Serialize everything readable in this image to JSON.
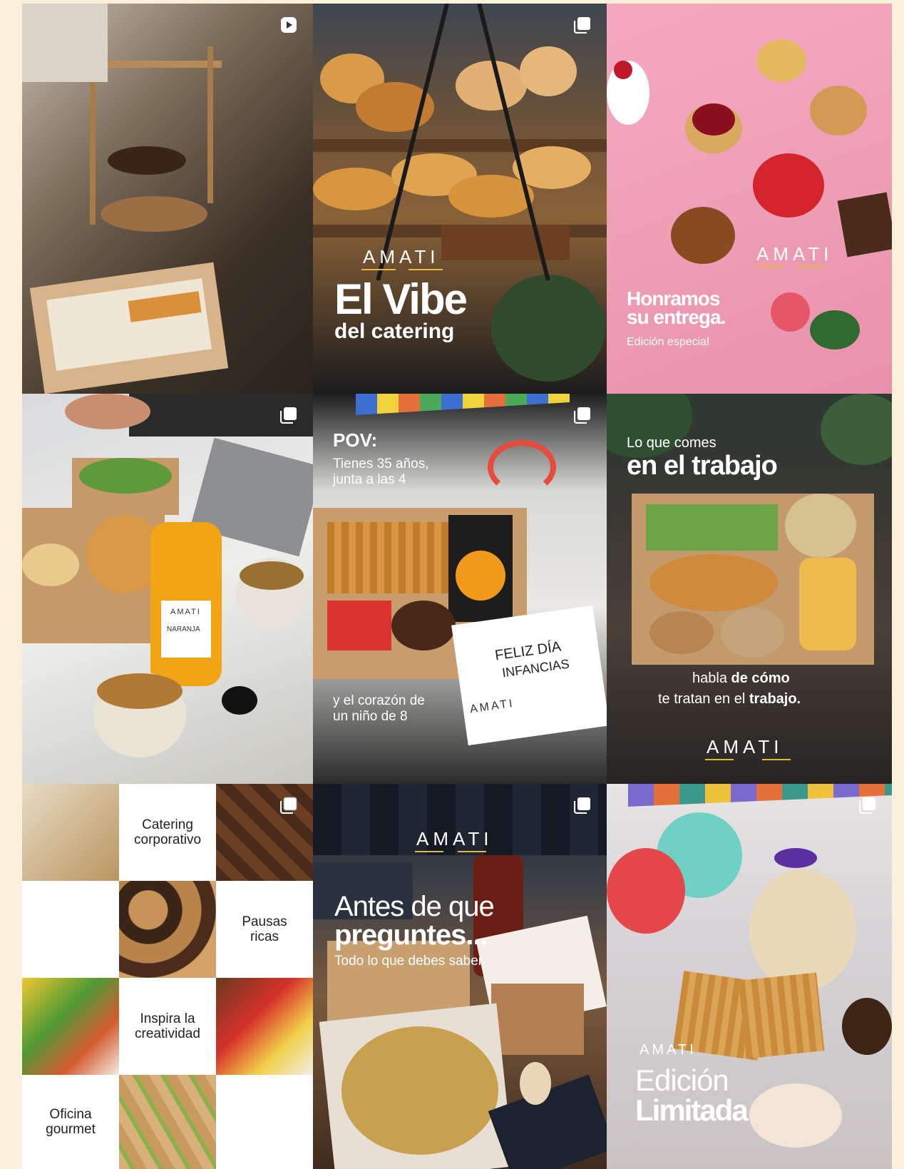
{
  "page": {
    "background": "#fbf0dc"
  },
  "posts": [
    {
      "badge": "reel-icon",
      "texts": {}
    },
    {
      "badge": "carousel-icon",
      "texts": {
        "brand": "AMATI",
        "title": "El Vibe",
        "subtitle": "del catering"
      }
    },
    {
      "badge": "",
      "texts": {
        "brand": "AMATI",
        "title": "Honramos",
        "title2": "su entrega.",
        "subtitle": "Edición especial"
      }
    },
    {
      "badge": "carousel-icon",
      "texts": {
        "bottle_brand": "AMATI",
        "bottle_label": "NARANJA"
      }
    },
    {
      "badge": "carousel-icon",
      "texts": {
        "pov": "POV:",
        "line1": "Tienes 35 años,",
        "line2": "junta a las 4",
        "line3": "y el corazón de",
        "line4": "un niño de 8",
        "card1": "FELIZ DÍA",
        "card2": "INFANCIAS",
        "brand": "AMATI"
      }
    },
    {
      "badge": "",
      "texts": {
        "top": "Lo que comes",
        "headline": "en el trabajo",
        "mid1_a": "habla ",
        "mid1_b": "de ",
        "mid1_c": "cómo",
        "mid2_a": "te tratan en el ",
        "mid2_b": "trabajo.",
        "brand": "AMATI"
      }
    },
    {
      "badge": "carousel-icon",
      "texts": {
        "c1": "Catering corporativo",
        "c2": "Pausas ricas",
        "c3": "Inspira la creatividad",
        "c4": "Oficina gourmet"
      }
    },
    {
      "badge": "carousel-icon",
      "texts": {
        "brand": "AMATI",
        "title": "Antes de que",
        "title2": "preguntes...",
        "subtitle": "Todo lo que debes saber"
      }
    },
    {
      "badge": "carousel-icon",
      "texts": {
        "brand": "AMATI",
        "title": "Edición",
        "title2": "Limitada"
      }
    }
  ]
}
